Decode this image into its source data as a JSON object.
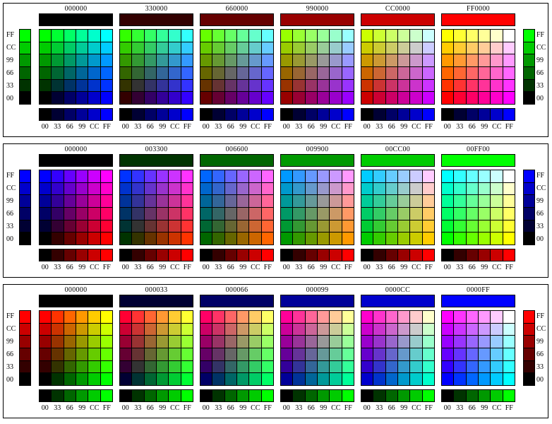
{
  "panels": [
    {
      "headers": [
        "000000",
        "330000",
        "660000",
        "990000",
        "CC0000",
        "FF0000"
      ],
      "side_labels": [
        "FF",
        "CC",
        "99",
        "66",
        "33",
        "00"
      ],
      "bottom_labels": [
        "00",
        "33",
        "66",
        "99",
        "CC",
        "FF"
      ]
    },
    {
      "headers": [
        "000000",
        "003300",
        "006600",
        "009900",
        "00CC00",
        "00FF00"
      ],
      "side_labels": [
        "FF",
        "CC",
        "99",
        "66",
        "33",
        "00"
      ],
      "bottom_labels": [
        "00",
        "33",
        "66",
        "99",
        "CC",
        "FF"
      ]
    },
    {
      "headers": [
        "000000",
        "000033",
        "000066",
        "000099",
        "0000CC",
        "0000FF"
      ],
      "side_labels": [
        "FF",
        "CC",
        "99",
        "66",
        "33",
        "00"
      ],
      "bottom_labels": [
        "00",
        "33",
        "66",
        "99",
        "CC",
        "FF"
      ]
    }
  ],
  "levels": [
    "00",
    "33",
    "66",
    "99",
    "CC",
    "FF"
  ]
}
